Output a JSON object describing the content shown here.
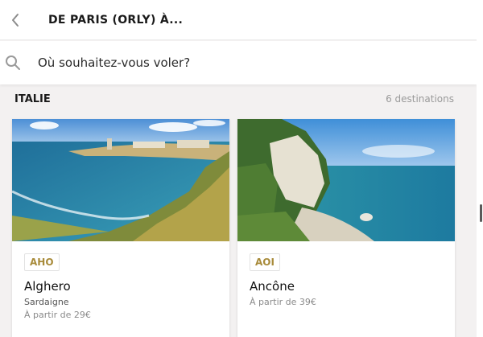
{
  "header": {
    "title": "DE PARIS (ORLY) À..."
  },
  "search": {
    "placeholder": "Où souhaitez-vous voler?"
  },
  "section": {
    "title": "ITALIE",
    "count": "6 destinations"
  },
  "destinations": [
    {
      "code": "AHO",
      "city": "Alghero",
      "region": "Sardaigne",
      "price": "À partir de 29€"
    },
    {
      "code": "AOI",
      "city": "Ancône",
      "region": "",
      "price": "À partir de 39€"
    }
  ],
  "icons": {
    "back": "chevron-left-icon",
    "search": "search-icon"
  },
  "colors": {
    "accent": "#a88b3a",
    "background": "#f3f1f1"
  }
}
